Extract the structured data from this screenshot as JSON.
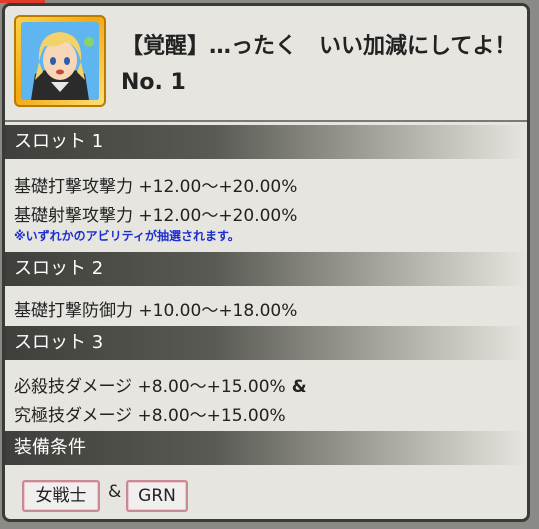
{
  "header": {
    "title": "【覚醒】…ったく　いい加減にしてよ！",
    "number": "No. 1"
  },
  "slots": [
    {
      "label": "スロット 1",
      "lines": [
        "基礎打撃攻撃力 +12.00〜+20.00%",
        "基礎射撃攻撃力 +12.00〜+20.00%"
      ],
      "note": "※いずれかのアビリティが抽選されます。"
    },
    {
      "label": "スロット 2",
      "lines": [
        "基礎打撃防御力 +10.00〜+18.00%"
      ]
    },
    {
      "label": "スロット 3",
      "lines": [
        "必殺技ダメージ +8.00〜+15.00%",
        "究極技ダメージ +8.00〜+15.00%"
      ],
      "line1_suffix": "&"
    }
  ],
  "equip": {
    "label": "装備条件",
    "tags": [
      "女戦士",
      "GRN"
    ],
    "joiner": "&"
  },
  "colors": {
    "note": "#1c2fd0",
    "tag_border": "#c98a94",
    "portrait_frame": "#f3a712"
  }
}
